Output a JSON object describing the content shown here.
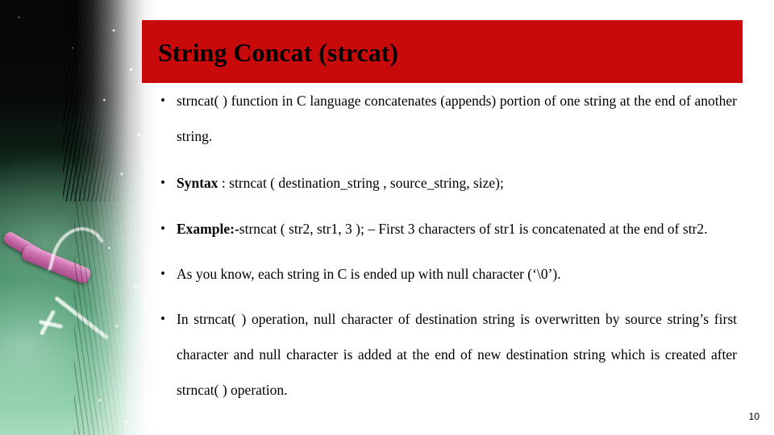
{
  "slide": {
    "title": "String Concat (strcat)",
    "page_number": "10",
    "accent_color": "#C90A0A",
    "title_text_color": "#000000",
    "background_color": "#FFFFFF",
    "bullet_glyph": "•"
  },
  "decor": {
    "name": "chalkboard-photo",
    "board_color": "#2F6B4B",
    "chalk_color": "#CC6FAE",
    "mark_color": "#FFFFFF"
  },
  "bullets": [
    {
      "id": "bullet-strncat-intro",
      "lead": "",
      "text": "strncat( ) function in C language concatenates (appends) portion of one string at the end of another string."
    },
    {
      "id": "bullet-syntax",
      "lead": "Syntax",
      "text": " : strncat ( destination_string , source_string, size);"
    },
    {
      "id": "bullet-example",
      "lead": "Example:-",
      "text": "strncat (  str2,  str1,  3  );  –  First  3  characters  of  str1  is concatenated at the end of str2."
    },
    {
      "id": "bullet-null-character",
      "lead": "",
      "text": "As you know, each string in C is ended up with null character (‘\\0’)."
    },
    {
      "id": "bullet-overwrite",
      "lead": "",
      "text": "In strncat( ) operation, null character of destination string is overwritten by source string’s first character and null character is added at the end of new destination string which is created after strncat( ) operation."
    }
  ]
}
